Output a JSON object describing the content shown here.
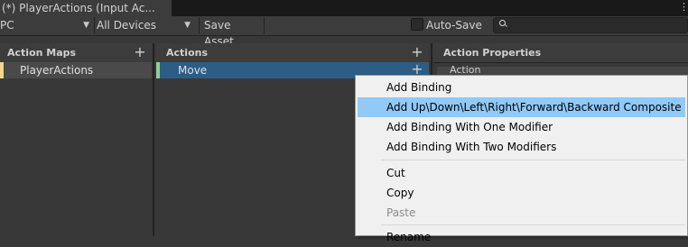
{
  "window": {
    "tab_title": "(*) PlayerActions (Input Ac...",
    "menu_icon": "kebab-menu-icon"
  },
  "toolbar": {
    "control_scheme": "PC",
    "devices": "All Devices",
    "save_asset": "Save Asset",
    "auto_save_label": "Auto-Save",
    "auto_save_checked": false,
    "search_value": ""
  },
  "panels": {
    "action_maps": {
      "title": "Action Maps",
      "items": [
        {
          "label": "PlayerActions",
          "marker_color": "#f0d98a"
        }
      ]
    },
    "actions": {
      "title": "Actions",
      "items": [
        {
          "label": "Move",
          "marker_color": "#8fd08f",
          "selected": true
        }
      ]
    },
    "properties": {
      "title": "Action Properties",
      "section": "Action"
    }
  },
  "context_menu": {
    "items": [
      {
        "label": "Add Binding",
        "enabled": true
      },
      {
        "label": "Add Up\\Down\\Left\\Right\\Forward\\Backward Composite",
        "enabled": true,
        "hovered": true
      },
      {
        "label": "Add Binding With One Modifier",
        "enabled": true
      },
      {
        "label": "Add Binding With Two Modifiers",
        "enabled": true
      },
      {
        "label": "Cut",
        "enabled": true
      },
      {
        "label": "Copy",
        "enabled": true
      },
      {
        "label": "Paste",
        "enabled": false
      },
      {
        "label": "Rename",
        "enabled": true
      }
    ]
  },
  "colors": {
    "selection": "#2c5d87",
    "menu_hover": "#91c9f7",
    "background": "#383838"
  }
}
